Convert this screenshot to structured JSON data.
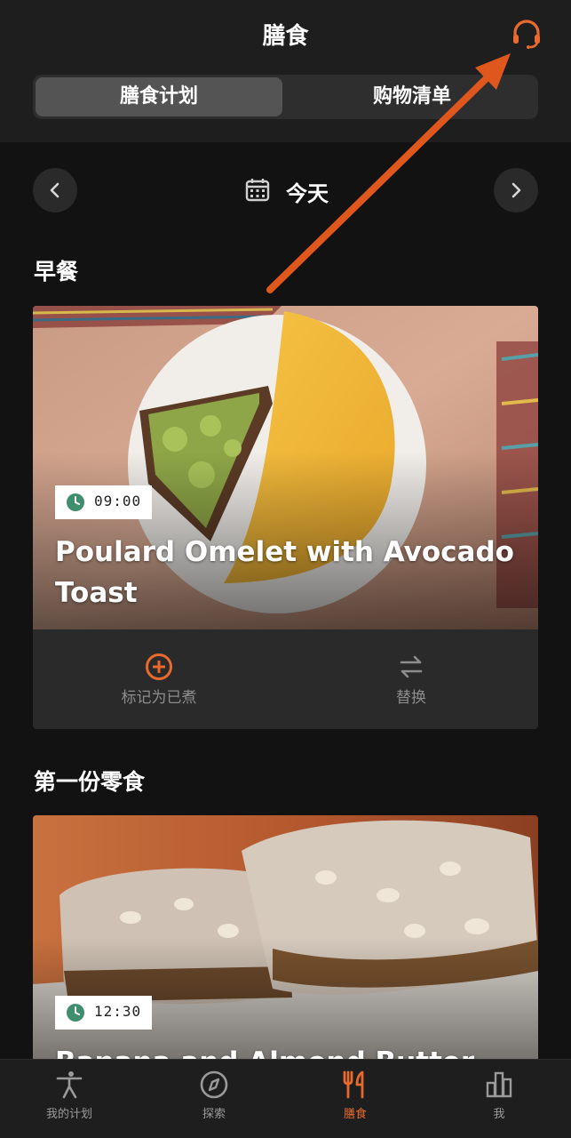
{
  "header": {
    "title": "膳食"
  },
  "segments": [
    {
      "label": "膳食计划"
    },
    {
      "label": "购物清单"
    }
  ],
  "date_nav": {
    "label": "今天"
  },
  "sections": [
    {
      "title": "早餐",
      "time": "09:00",
      "meal": "Poulard Omelet with Avocado Toast",
      "mark_label": "标记为已煮",
      "swap_label": "替换"
    },
    {
      "title": "第一份零食",
      "time": "12:30",
      "meal": "Banana and Almond Butter"
    }
  ],
  "tabs": [
    {
      "label": "我的计划",
      "icon": "stretch-person-icon"
    },
    {
      "label": "探索",
      "icon": "compass-icon"
    },
    {
      "label": "膳食",
      "icon": "fork-knife-icon"
    },
    {
      "label": "我",
      "icon": "bar-chart-icon"
    }
  ],
  "colors": {
    "accent": "#e86a2e",
    "background": "#121212",
    "header": "#1e1e1e",
    "clock": "#3f8f6f"
  }
}
